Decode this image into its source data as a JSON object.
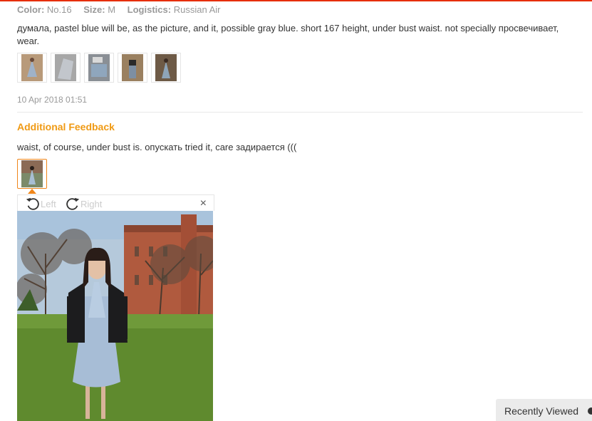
{
  "meta": {
    "color_label": "Color:",
    "color_value": "No.16",
    "size_label": "Size:",
    "size_value": "M",
    "logistics_label": "Logistics:",
    "logistics_value": "Russian Air"
  },
  "review": {
    "text": "думала, pastel blue will be, as the picture, and it, possible gray blue. short 167 height, under bust waist. not specially просвечивает, wear.",
    "thumbnail_count": 5,
    "date": "10 Apr 2018 01:51"
  },
  "additional": {
    "title": "Additional Feedback",
    "text": "waist, of course, under bust is. опускать tried it, care задирается (((",
    "thumbnail_count": 1
  },
  "viewer": {
    "rotate_left_label": "Left",
    "rotate_right_label": "Right",
    "close_label": "×"
  },
  "recently_viewed": {
    "label": "Recently Viewed"
  },
  "colors": {
    "accent_orange": "#f09a14",
    "top_line": "#e62e04"
  }
}
